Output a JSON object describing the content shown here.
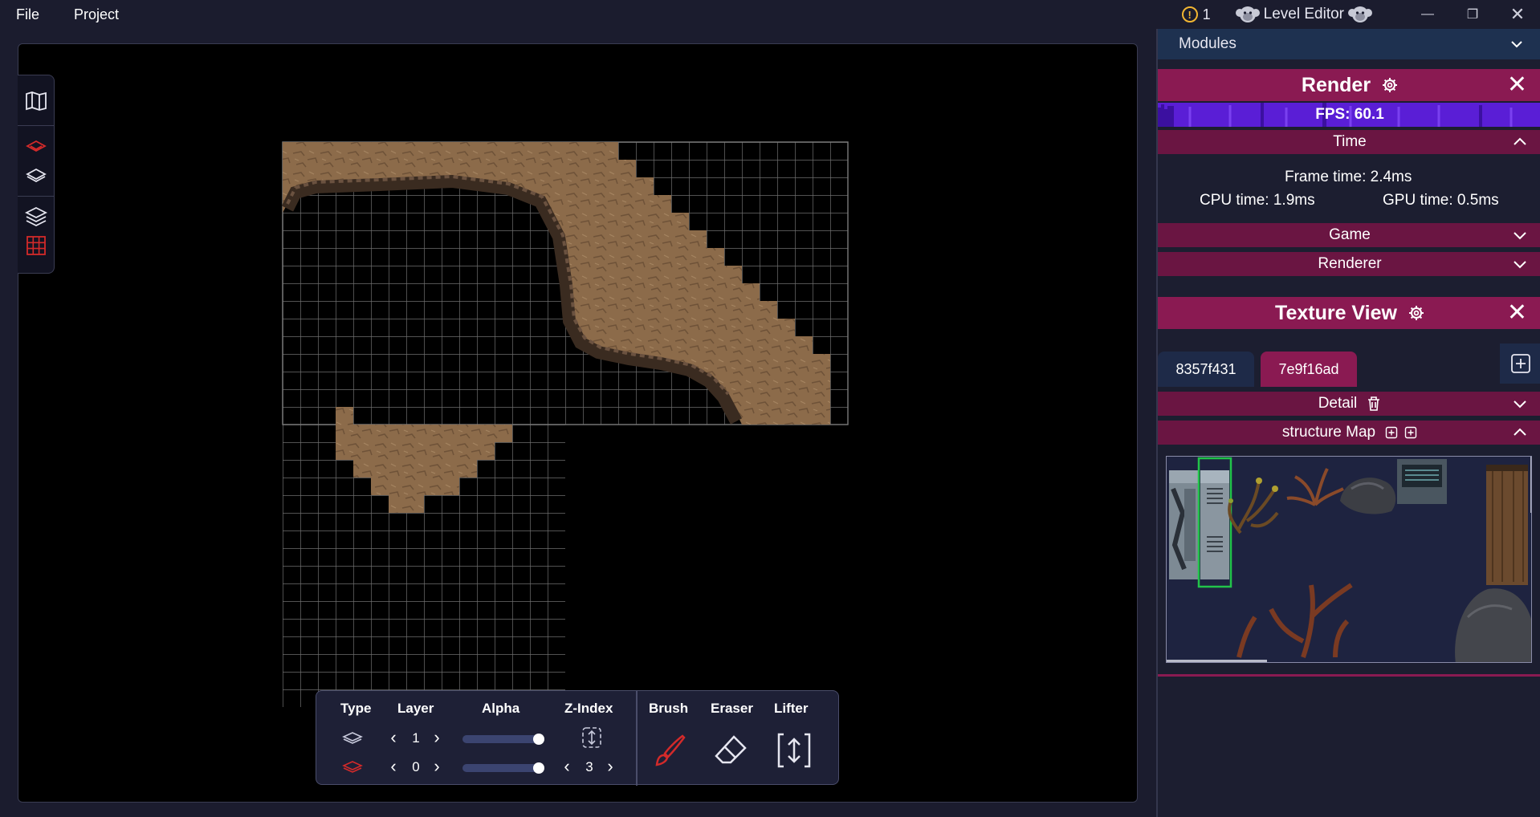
{
  "menu": {
    "file": "File",
    "project": "Project"
  },
  "title": {
    "warning_count": "1",
    "app_name": "Level Editor"
  },
  "modules": {
    "label": "Modules"
  },
  "render": {
    "title": "Render",
    "fps": "FPS: 60.1",
    "time_label": "Time",
    "frame_time": "Frame time: 2.4ms",
    "cpu_time": "CPU time: 1.9ms",
    "gpu_time": "GPU time: 0.5ms",
    "game_label": "Game",
    "renderer_label": "Renderer"
  },
  "texture_view": {
    "title": "Texture View",
    "tabs": [
      "8357f431",
      "7e9f16ad"
    ],
    "active_tab": "7e9f16ad",
    "detail_label": "Detail",
    "structure_label": "structure Map"
  },
  "tool_panel": {
    "type_label": "Type",
    "layer_label": "Layer",
    "alpha_label": "Alpha",
    "zindex_label": "Z-Index",
    "brush_label": "Brush",
    "eraser_label": "Eraser",
    "lifter_label": "Lifter",
    "layer_top": "1",
    "layer_bottom": "0",
    "zindex_value": "3",
    "alpha_top": 0.95,
    "alpha_bottom": 0.95
  },
  "colors": {
    "accent_magenta": "#8a1a52",
    "fps_purple": "#5b1fd8",
    "dirt": "#8a6a4a",
    "selection_green": "#22c44a",
    "active_red": "#d32a2a"
  }
}
